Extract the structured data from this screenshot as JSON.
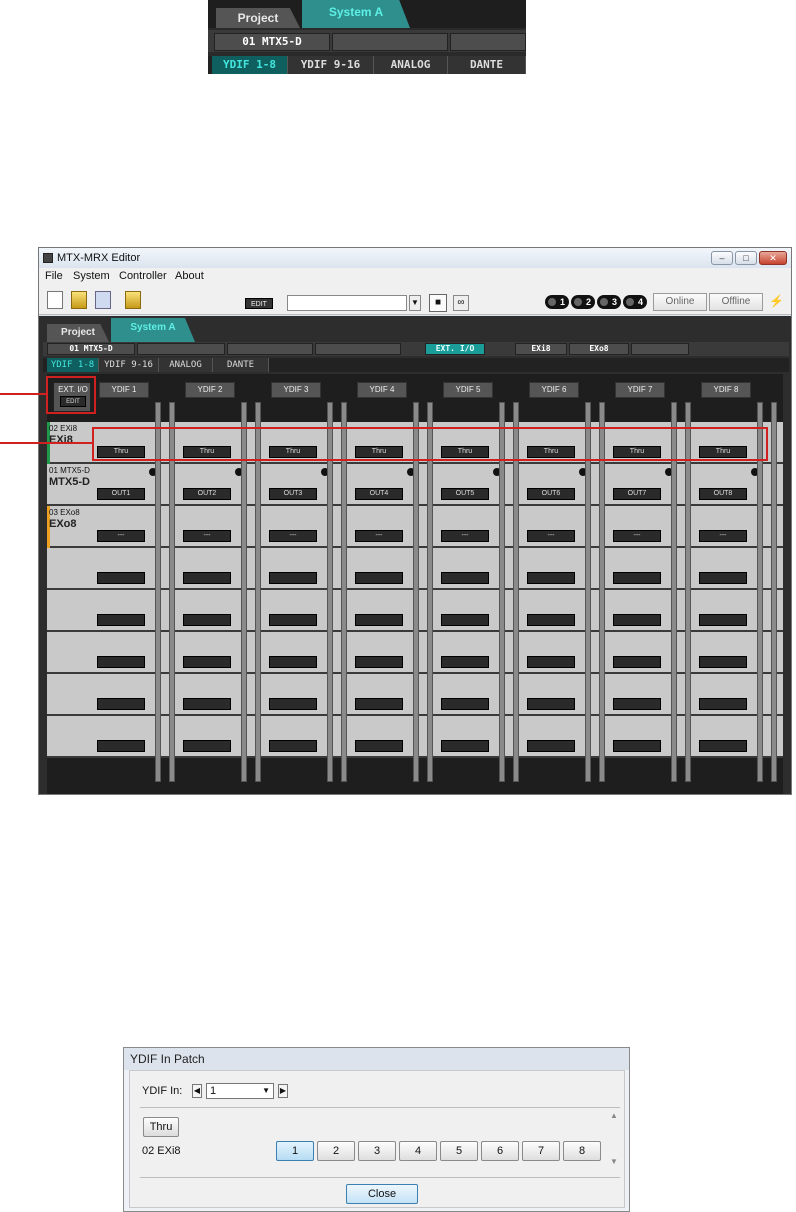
{
  "fig1": {
    "tabs": [
      "Project",
      "System A"
    ],
    "devices": [
      "01 MTX5-D",
      "",
      ""
    ],
    "pages": [
      "YDIF 1-8",
      "YDIF 9-16",
      "ANALOG",
      "DANTE"
    ]
  },
  "window": {
    "title": "MTX-MRX Editor",
    "menu": [
      "File",
      "System",
      "Controller",
      "About"
    ],
    "toolbar": {
      "edit_label": "EDIT",
      "preset_value": "",
      "dots": [
        "1",
        "2",
        "3",
        "4"
      ],
      "online": "Online",
      "offline": "Offline"
    },
    "tabs": [
      "Project",
      "System A"
    ],
    "devices": [
      "01 MTX5-D",
      "",
      "",
      "",
      "EXT. I/O",
      "EXi8",
      "EXo8",
      ""
    ],
    "pages": [
      "YDIF 1-8",
      "YDIF 9-16",
      "ANALOG",
      "DANTE"
    ],
    "ext_io": {
      "label": "EXT. I/O",
      "edit": "EDIT"
    },
    "columns": [
      "YDIF 1",
      "YDIF 2",
      "YDIF 3",
      "YDIF 4",
      "YDIF 5",
      "YDIF 6",
      "YDIF 7",
      "YDIF 8"
    ],
    "rows": [
      {
        "id": "02 EXi8",
        "name": "EXi8",
        "stripe": "#1f9a4a",
        "buttons": [
          "Thru",
          "Thru",
          "Thru",
          "Thru",
          "Thru",
          "Thru",
          "Thru",
          "Thru"
        ]
      },
      {
        "id": "01 MTX5-D",
        "name": "MTX5-D",
        "stripe": "",
        "buttons": [
          "OUT1",
          "OUT2",
          "OUT3",
          "OUT4",
          "OUT5",
          "OUT6",
          "OUT7",
          "OUT8"
        ]
      },
      {
        "id": "03 EXo8",
        "name": "EXo8",
        "stripe": "#f0a020",
        "buttons": [
          "---",
          "---",
          "---",
          "---",
          "---",
          "---",
          "---",
          "---"
        ]
      },
      {
        "id": "",
        "name": "",
        "stripe": "",
        "buttons": [
          "",
          "",
          "",
          "",
          "",
          "",
          "",
          ""
        ]
      },
      {
        "id": "",
        "name": "",
        "stripe": "",
        "buttons": [
          "",
          "",
          "",
          "",
          "",
          "",
          "",
          ""
        ]
      },
      {
        "id": "",
        "name": "",
        "stripe": "",
        "buttons": [
          "",
          "",
          "",
          "",
          "",
          "",
          "",
          ""
        ]
      },
      {
        "id": "",
        "name": "",
        "stripe": "",
        "buttons": [
          "",
          "",
          "",
          "",
          "",
          "",
          "",
          ""
        ]
      },
      {
        "id": "",
        "name": "",
        "stripe": "",
        "buttons": [
          "",
          "",
          "",
          "",
          "",
          "",
          "",
          ""
        ]
      }
    ]
  },
  "dialog": {
    "title": "YDIF In Patch",
    "ydif_label": "YDIF In:",
    "ydif_value": "1",
    "thru": "Thru",
    "device": "02 EXi8",
    "channels": [
      "1",
      "2",
      "3",
      "4",
      "5",
      "6",
      "7",
      "8"
    ],
    "selected_channel": "1",
    "close": "Close"
  },
  "colors": {
    "accent_teal": "#2f8f8d",
    "callout_red": "#d12020"
  }
}
